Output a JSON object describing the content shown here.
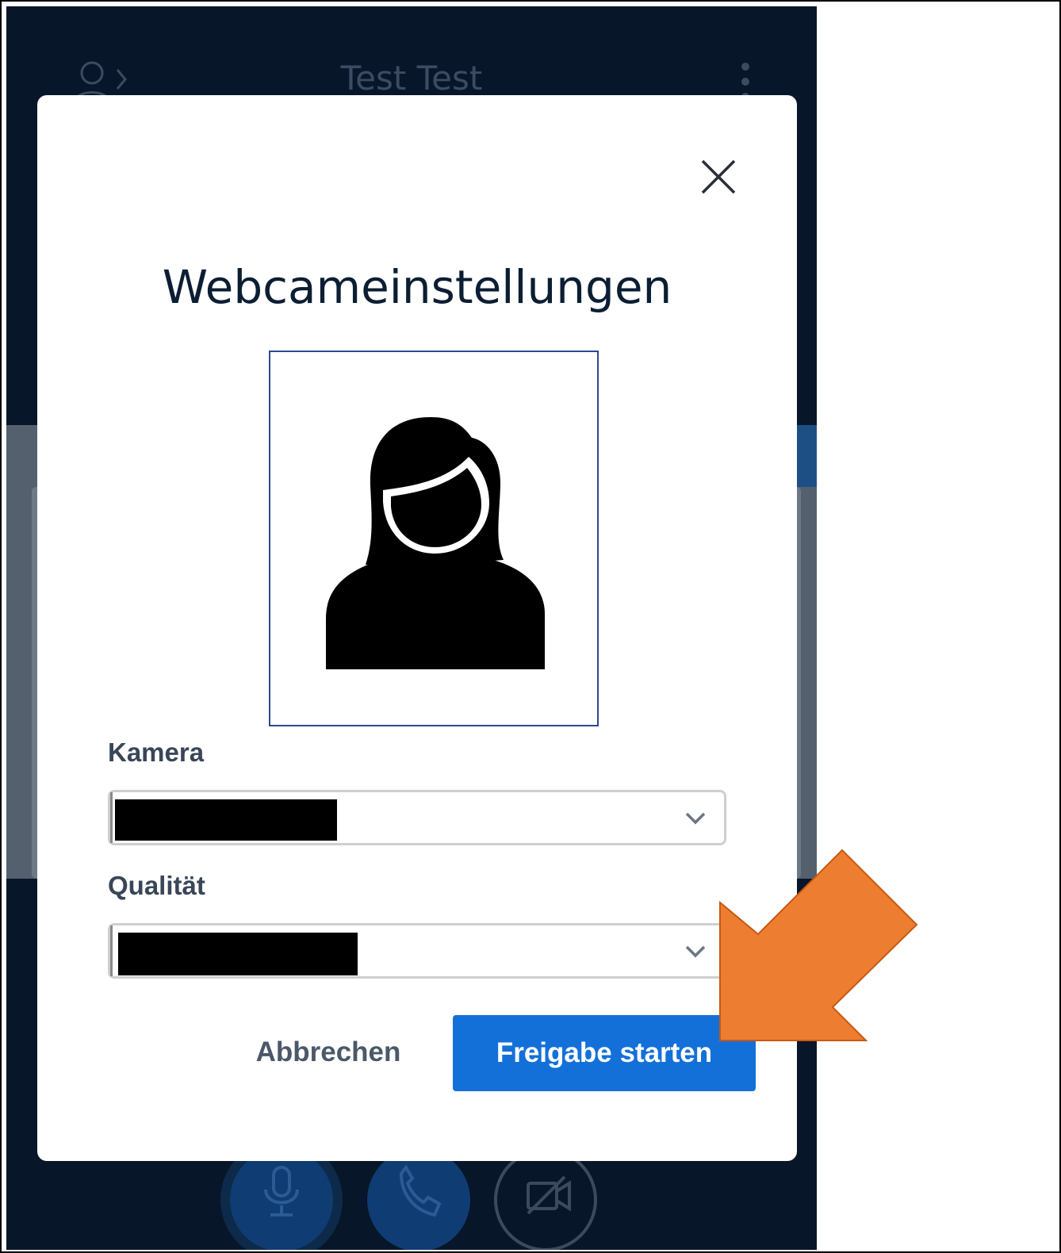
{
  "app": {
    "meeting_title": "Test Test"
  },
  "modal": {
    "title": "Webcameinstellungen",
    "camera_label": "Kamera",
    "quality_label": "Qualität",
    "cancel_label": "Abbrechen",
    "start_label": "Freigabe starten"
  },
  "colors": {
    "background_dark": "#081629",
    "primary_button": "#1370d9",
    "annotation_arrow": "#ed7d31"
  },
  "icons": {
    "top_left": "user-list-icon",
    "top_right": "options-icon",
    "close": "close-icon",
    "preview": "avatar-placeholder-icon",
    "select": "chevron-down-icon",
    "controls": [
      "microphone-icon",
      "phone-icon",
      "camera-off-icon"
    ],
    "annotation": "arrow-annotation"
  }
}
